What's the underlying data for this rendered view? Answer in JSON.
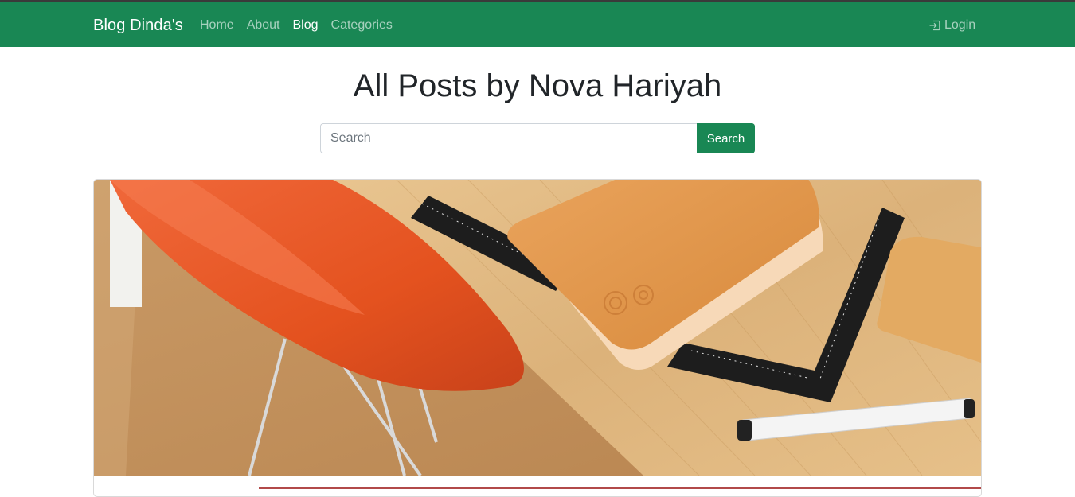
{
  "navbar": {
    "brand": "Blog Dinda's",
    "links": [
      {
        "label": "Home",
        "active": false
      },
      {
        "label": "About",
        "active": false
      },
      {
        "label": "Blog",
        "active": true
      },
      {
        "label": "Categories",
        "active": false
      }
    ],
    "login_label": "Login",
    "login_icon": "box-arrow-in-right-icon",
    "bg_color": "#198754"
  },
  "main": {
    "title": "All Posts by Nova Hariyah",
    "search": {
      "placeholder": "Search",
      "value": "",
      "button_label": "Search"
    },
    "featured_post": {
      "image": "photo of orange plastic chair beside wooden desk with leather notebook, black rulers and white marker"
    }
  }
}
